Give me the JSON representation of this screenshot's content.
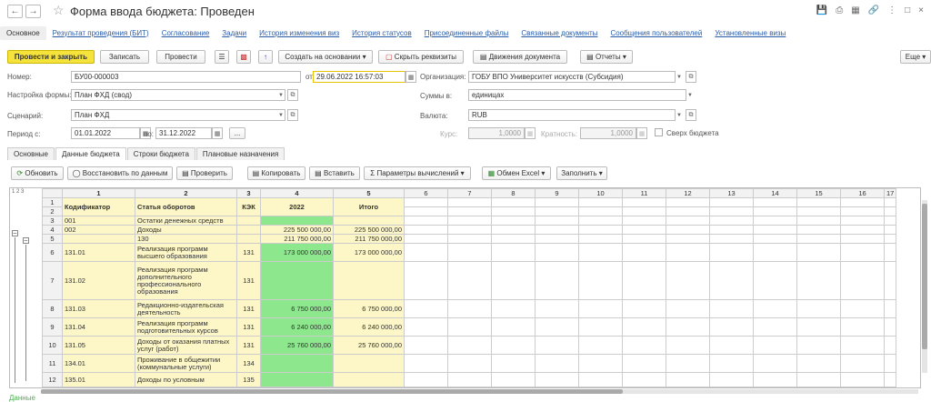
{
  "window": {
    "title": "Форма ввода бюджета: Проведен"
  },
  "nav_tabs": [
    "Основное",
    "Результат проведения (БИТ)",
    "Согласование",
    "Задачи",
    "История изменения виз",
    "История статусов",
    "Присоединенные файлы",
    "Связанные документы",
    "Сообщения пользователей",
    "Установленные визы"
  ],
  "toolbar": {
    "post_close": "Провести и закрыть",
    "save": "Записать",
    "post": "Провести",
    "create_based": "Создать на основании",
    "hide_req": "Скрыть реквизиты",
    "movements": "Движения документа",
    "reports": "Отчеты",
    "more": "Еще"
  },
  "form": {
    "number_label": "Номер:",
    "number": "БУ00-000003",
    "from_label": "от:",
    "date": "29.06.2022 16:57:03",
    "org_label": "Организация:",
    "org": "ГОБУ ВПО Университет искусств (Субсидия)",
    "form_setup_label": "Настройка формы:",
    "form_setup": "План ФХД (свод)",
    "sums_label": "Суммы в:",
    "sums": "единицах",
    "scenario_label": "Сценарий:",
    "scenario": "План ФХД",
    "currency_label": "Валюта:",
    "currency": "RUB",
    "period_label": "Период с:",
    "period_from": "01.01.2022",
    "period_to_label": "по:",
    "period_to": "31.12.2022",
    "period_btn": "...",
    "rate_label": "Курс:",
    "rate": "1,0000",
    "mult_label": "Кратность:",
    "mult": "1,0000",
    "over_budget": "Сверх бюджета"
  },
  "sub_tabs": [
    "Основные",
    "Данные бюджета",
    "Строки бюджета",
    "Плановые назначения"
  ],
  "grid_toolbar": {
    "refresh": "Обновить",
    "restore": "Восстановить по данным",
    "check": "Проверить",
    "copy": "Копировать",
    "paste": "Вставить",
    "calc_params": "Параметры вычислений",
    "excel": "Обмен Excel",
    "fill": "Заполнить"
  },
  "grid": {
    "levels": "1 2 3",
    "col_numbers": [
      "1",
      "2",
      "3",
      "4",
      "5",
      "6",
      "7",
      "8",
      "9",
      "10",
      "11",
      "12",
      "13",
      "14",
      "15",
      "16",
      "17"
    ],
    "headers": {
      "code": "Кодификатор",
      "item": "Статья оборотов",
      "kek": "КЭК",
      "year": "2022",
      "total": "Итого"
    },
    "rows": [
      {
        "n": "3",
        "code": "001",
        "item": "Остатки денежных средств",
        "kek": "",
        "v": "",
        "t": ""
      },
      {
        "n": "4",
        "code": "002",
        "item": "Доходы",
        "kek": "",
        "v": "225 500 000,00",
        "t": "225 500 000,00"
      },
      {
        "n": "5",
        "code": "",
        "item": "130",
        "kek": "",
        "v": "211 750 000,00",
        "t": "211 750 000,00"
      },
      {
        "n": "6",
        "code": "131.01",
        "item": "Реализация программ высшего образования",
        "kek": "131",
        "v": "173 000 000,00",
        "t": "173 000 000,00"
      },
      {
        "n": "7",
        "code": "131.02",
        "item": "Реализация программ дополнительного профессионального образования",
        "kek": "131",
        "v": "",
        "t": ""
      },
      {
        "n": "8",
        "code": "131.03",
        "item": "Редакционно-издательская деятельность",
        "kek": "131",
        "v": "6 750 000,00",
        "t": "6 750 000,00"
      },
      {
        "n": "9",
        "code": "131.04",
        "item": "Реализация программ подготовительных курсов",
        "kek": "131",
        "v": "6 240 000,00",
        "t": "6 240 000,00"
      },
      {
        "n": "10",
        "code": "131.05",
        "item": "Доходы от оказания платных услуг (работ)",
        "kek": "131",
        "v": "25 760 000,00",
        "t": "25 760 000,00"
      },
      {
        "n": "11",
        "code": "134.01",
        "item": "Проживание в общежитии (коммунальные услуги)",
        "kek": "134",
        "v": "",
        "t": ""
      },
      {
        "n": "12",
        "code": "135.01",
        "item": "Доходы по условным",
        "kek": "135",
        "v": "",
        "t": ""
      }
    ]
  },
  "footer": {
    "text": "Данные"
  }
}
